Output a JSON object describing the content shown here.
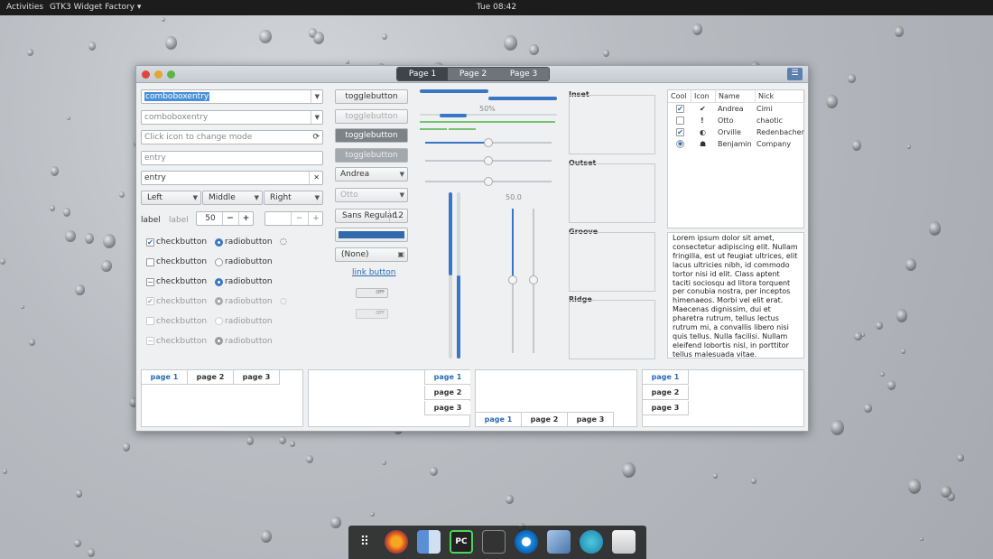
{
  "topbar": {
    "activities": "Activities",
    "app": "GTK3 Widget Factory ▾",
    "clock": "Tue 08:42"
  },
  "window": {
    "tabs": [
      "Page 1",
      "Page 2",
      "Page 3"
    ],
    "menu_icon": "menu-icon"
  },
  "col1": {
    "combo1": "comboboxentry",
    "combo2": "comboboxentry",
    "icon_entry_placeholder": "Click icon to change mode",
    "entry_placeholder": "entry",
    "entry_value": "entry",
    "seg": [
      "Left",
      "Middle",
      "Right"
    ],
    "label1": "label",
    "label2": "label",
    "spin_value": "50",
    "checks": [
      "checkbutton",
      "checkbutton",
      "checkbutton",
      "checkbutton",
      "checkbutton",
      "checkbutton"
    ],
    "radios": [
      "radiobutton",
      "radiobutton",
      "radiobutton",
      "radiobutton",
      "radiobutton",
      "radiobutton"
    ]
  },
  "col2": {
    "toggles": [
      "togglebutton",
      "togglebutton",
      "togglebutton",
      "togglebutton"
    ],
    "combo1": "Andrea",
    "combo2": "Otto",
    "font_name": "Sans Regular",
    "font_size": "12",
    "file": "(None)",
    "link": "link button",
    "switch1": "OFF",
    "switch2": "OFF",
    "accent": "#2f6aad"
  },
  "col3": {
    "progress_label": "50%",
    "scale_value": "50.0",
    "progress_value": 0.5
  },
  "frames": [
    "Inset",
    "Outset",
    "Groove",
    "Ridge"
  ],
  "tree": {
    "headers": [
      "Cool",
      "Icon",
      "Name",
      "Nick"
    ],
    "rows": [
      {
        "name": "Andrea",
        "nick": "Cimi",
        "cool": "✔",
        "icon": "✔"
      },
      {
        "name": "Otto",
        "nick": "chaotic",
        "cool": "",
        "icon": "!"
      },
      {
        "name": "Orville",
        "nick": "Redenbacher",
        "cool": "✔",
        "icon": "◐"
      },
      {
        "name": "Benjamin",
        "nick": "Company",
        "cool": "◉",
        "icon": "☗"
      }
    ]
  },
  "textview": "Lorem ipsum dolor sit amet, consectetur adipiscing elit. Nullam fringilla, est ut feugiat ultrices, elit lacus ultricies nibh, id commodo tortor nisi id elit. Class aptent taciti sociosqu ad litora torquent per conubia nostra, per inceptos himenaeos. Morbi vel elit erat. Maecenas dignissim, dui et pharetra rutrum, tellus lectus rutrum mi, a convallis libero nisi quis tellus. Nulla facilisi. Nullam eleifend lobortis nisl, in porttitor tellus malesuada vitae.",
  "notebooks": {
    "tabs": [
      "page 1",
      "page 2",
      "page 3"
    ]
  }
}
